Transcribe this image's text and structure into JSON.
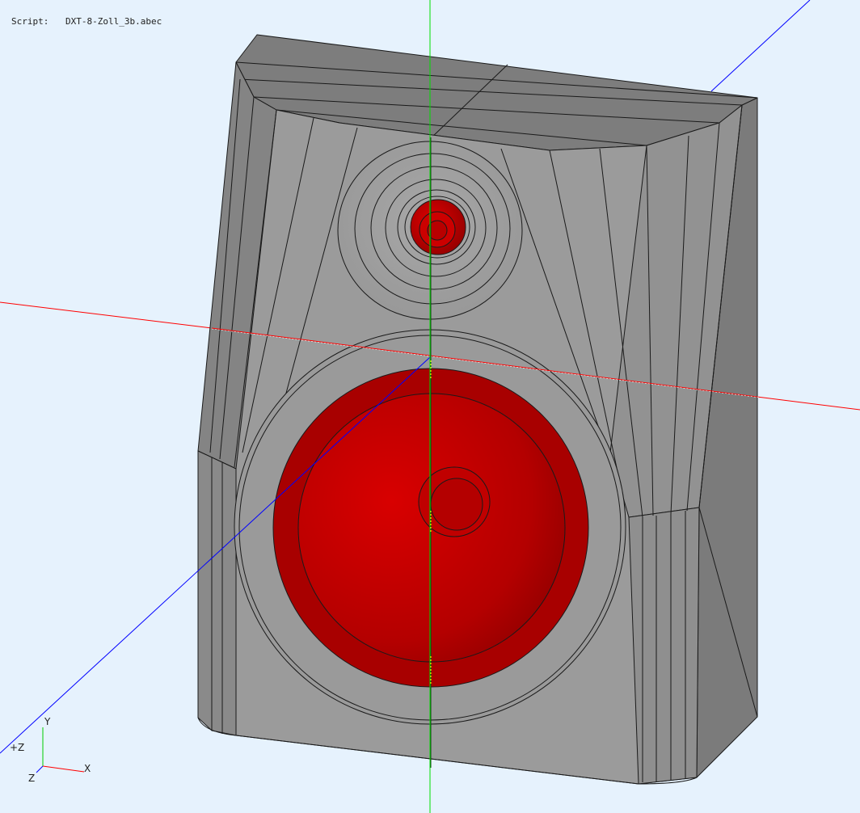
{
  "header": {
    "script_label": "Script:",
    "script_file": "DXT-8-Zoll_3b.abec"
  },
  "axis_triad": {
    "y_label": "Y",
    "z_plus_label": "+Z",
    "z_label": "Z",
    "x_label": "X"
  },
  "colors": {
    "background": "#e6f2fd",
    "cabinet_face": "#9c9c9c",
    "cabinet_side": "#7a7a7a",
    "driver_red": "#c80000",
    "axis_x": "#ff0000",
    "axis_y": "#00dd00",
    "axis_z": "#0000ff"
  }
}
